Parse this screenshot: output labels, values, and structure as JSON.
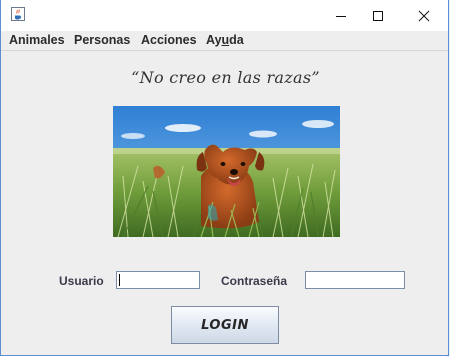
{
  "window": {
    "icons": {
      "app": "java-cup-icon",
      "minimize": "minimize-icon",
      "maximize": "maximize-icon",
      "close": "close-icon"
    }
  },
  "menubar": {
    "items": [
      {
        "label": "Animales"
      },
      {
        "label": "Personas"
      },
      {
        "label": "Acciones"
      },
      {
        "label_prefix": "Ay",
        "label_mnemonic": "u",
        "label_suffix": "da"
      }
    ]
  },
  "main": {
    "quote": "“No creo en las razas”",
    "image": "dog-in-wheat-field",
    "user_label": "Usuario",
    "user_value": "",
    "password_label": "Contraseña",
    "password_value": "",
    "login_label": "LOGIN"
  },
  "colors": {
    "accent_border": "#5a8fd6",
    "window_bg": "#eeeeee",
    "button_border": "#7d8da6"
  }
}
